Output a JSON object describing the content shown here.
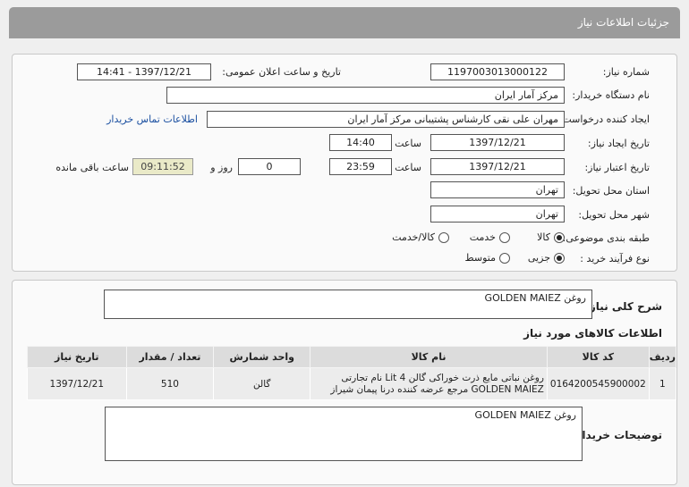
{
  "header": {
    "title": "جزئیات اطلاعات نیاز"
  },
  "form": {
    "need_number_label": "شماره نیاز:",
    "need_number": "1197003013000122",
    "announce_label": "تاریخ و ساعت اعلان عمومی:",
    "announce_value": "1397/12/21 - 14:41",
    "buyer_org_label": "نام دستگاه خریدار:",
    "buyer_org": "مرکز آمار ایران",
    "creator_label": "ایجاد کننده درخواست:",
    "creator": "مهران  علی نقی کارشناس پشتیبانی مرکز آمار ایران",
    "contact_link": "اطلاعات تماس خریدار",
    "created_date_label": "تاریخ ایجاد نیاز:",
    "created_date": "1397/12/21",
    "time_label": "ساعت",
    "created_time": "14:40",
    "validity_label": "تاریخ اعتبار نیاز:",
    "validity_date": "1397/12/21",
    "validity_time": "23:59",
    "days_label": "روز و",
    "days_value": "0",
    "remaining_time": "09:11:52",
    "remaining_label": "ساعت باقی مانده",
    "province_label": "استان محل تحویل:",
    "province": "تهران",
    "city_label": "شهر محل تحویل:",
    "city": "تهران",
    "category_label": "طبقه بندی موضوعی:",
    "category_options": [
      "کالا",
      "خدمت",
      "کالا/خدمت"
    ],
    "purchase_label": "نوع فرآیند خرید :",
    "purchase_options": [
      "جزیی",
      "متوسط"
    ]
  },
  "summary": {
    "label": "شرح کلی نیاز:",
    "value": "روغن GOLDEN MAIEZ"
  },
  "items": {
    "title": "اطلاعات کالاهای مورد نیاز",
    "columns": [
      "ردیف",
      "کد کالا",
      "نام کالا",
      "واحد شمارش",
      "تعداد / مقدار",
      "تاریخ نیاز"
    ],
    "rows": [
      {
        "row": "1",
        "code": "0164200545900002",
        "name": "روغن نباتی مایع ذرت خوراکی گالن 4 Lit نام تجارتی GOLDEN MAIEZ مرجع عرضه کننده درنا پیمان شیراز",
        "unit": "گالن",
        "qty": "510",
        "date": "1397/12/21"
      }
    ]
  },
  "buyer_notes": {
    "label": "توضیحات خریدار:",
    "value": "روغن GOLDEN MAIEZ"
  }
}
